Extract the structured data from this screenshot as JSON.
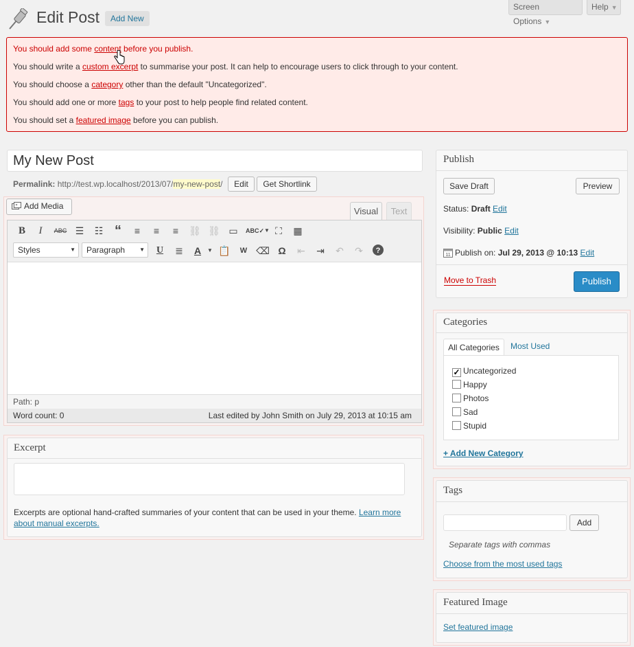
{
  "header": {
    "title": "Edit Post",
    "add_new": "Add New",
    "screen_options": "Screen Options",
    "help": "Help"
  },
  "notice": {
    "line1": {
      "pre": "You should add some ",
      "link": "content",
      "post": " before you publish."
    },
    "line2": {
      "pre": "You should write a ",
      "link": "custom excerpt",
      "post": " to summarise your post. It can help to encourage users to click through to your content."
    },
    "line3": {
      "pre": "You should choose a ",
      "link": "category",
      "post": " other than the default \"Uncategorized\"."
    },
    "line4": {
      "pre": "You should add one or more ",
      "link": "tags",
      "post": " to your post to help people find related content."
    },
    "line5": {
      "pre": "You should set a ",
      "link": "featured image",
      "post": " before you can publish."
    }
  },
  "post": {
    "title": "My New Post",
    "permalink_label": "Permalink:",
    "permalink_base": "http://test.wp.localhost/2013/07/",
    "permalink_slug": "my-new-post",
    "permalink_end": "/",
    "edit_btn": "Edit",
    "shortlink_btn": "Get Shortlink"
  },
  "editor": {
    "add_media": "Add Media",
    "tab_visual": "Visual",
    "tab_text": "Text",
    "styles_select": "Styles",
    "format_select": "Paragraph",
    "path": "Path: p",
    "word_count": "Word count: 0",
    "last_edited": "Last edited by John Smith on July 29, 2013 at 10:15 am"
  },
  "excerpt": {
    "heading": "Excerpt",
    "help_text": "Excerpts are optional hand-crafted summaries of your content that can be used in your theme. ",
    "help_link": "Learn more about manual excerpts."
  },
  "publish": {
    "heading": "Publish",
    "save_draft": "Save Draft",
    "preview": "Preview",
    "status_label": "Status: ",
    "status_value": "Draft",
    "visibility_label": "Visibility: ",
    "visibility_value": "Public",
    "publish_on_label": "Publish on: ",
    "publish_on_value": "Jul 29, 2013 @ 10:13",
    "edit": "Edit",
    "move_to_trash": "Move to Trash",
    "publish_btn": "Publish"
  },
  "categories": {
    "heading": "Categories",
    "tab_all": "All Categories",
    "tab_used": "Most Used",
    "items": [
      {
        "label": "Uncategorized",
        "checked": true
      },
      {
        "label": "Happy",
        "checked": false
      },
      {
        "label": "Photos",
        "checked": false
      },
      {
        "label": "Sad",
        "checked": false
      },
      {
        "label": "Stupid",
        "checked": false
      }
    ],
    "add_new": "+ Add New Category"
  },
  "tags": {
    "heading": "Tags",
    "add_btn": "Add",
    "note": "Separate tags with commas",
    "choose_link": "Choose from the most used tags"
  },
  "featured": {
    "heading": "Featured Image",
    "set_link": "Set featured image"
  },
  "colors": {
    "accent": "#21759b",
    "error": "#cc0000",
    "publish": "#2a8cc7"
  }
}
